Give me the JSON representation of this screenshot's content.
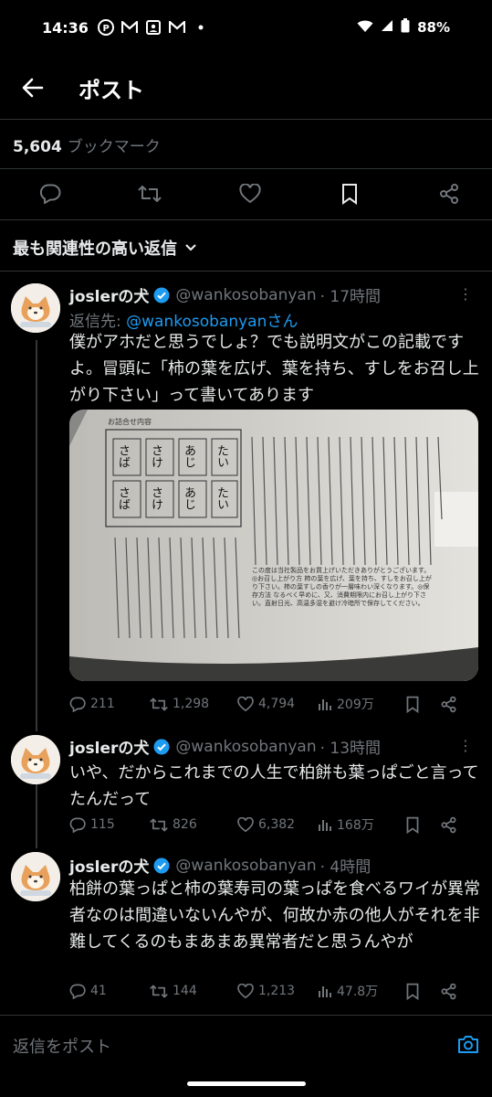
{
  "status": {
    "time": "14:36",
    "battery": "88%"
  },
  "header": {
    "title": "ポスト"
  },
  "bookmarks": {
    "count": "5,604",
    "label": "ブックマーク"
  },
  "sort": {
    "label": "最も関連性の高い返信"
  },
  "replies": [
    {
      "name": "joslerの犬",
      "handle": "@wankosobanyan",
      "time": "· 17時間",
      "reply_to_prefix": "返信先: ",
      "reply_to": "@wankosobanyanさん",
      "text": "僕がアホだと思うでしょ？でも説明文がこの記載ですよ。冒頭に「柿の葉を広げ、葉を持ち、すしをお召し上がり下さい」って書いてあります",
      "media": {
        "box_title": "お詰合せ内容",
        "labels": [
          "たい",
          "あじ",
          "さけ",
          "さば",
          "たい",
          "あじ",
          "さけ",
          "さば"
        ],
        "text": "この度は当社製品をお買上げいただきありがとうございます。◎お召し上がり方 柿の葉を広げ、葉を持ち、すしをお召し上がり下さい。柿の葉すしの香りが一層味わい深くなります。◎保存方法 なるべく早めに、又、消費期限内にお召し上がり下さい。直射日光、高温多湿を避け冷暗所で保存してください。"
      },
      "stats": {
        "replies": "211",
        "reposts": "1,298",
        "likes": "4,794",
        "views": "209万"
      }
    },
    {
      "name": "joslerの犬",
      "handle": "@wankosobanyan",
      "time": "· 13時間",
      "text": "いや、だからこれまでの人生で柏餅も葉っぱごと言ってたんだって",
      "stats": {
        "replies": "115",
        "reposts": "826",
        "likes": "6,382",
        "views": "168万"
      }
    },
    {
      "name": "joslerの犬",
      "handle": "@wankosobanyan",
      "time": "· 4時間",
      "text": "柏餅の葉っぱと柿の葉寿司の葉っぱを食べるワイが異常者なのは間違いないんやが、何故か赤の他人がそれを非難してくるのもまあまあ異常者だと思うんやが",
      "stats": {
        "replies": "41",
        "reposts": "144",
        "likes": "1,213",
        "views": "47.8万"
      }
    }
  ],
  "compose": {
    "placeholder": "返信をポスト"
  },
  "colors": {
    "accent": "#1d9bf0",
    "muted": "#71767b",
    "text": "#e7e9ea",
    "background": "#000000"
  }
}
